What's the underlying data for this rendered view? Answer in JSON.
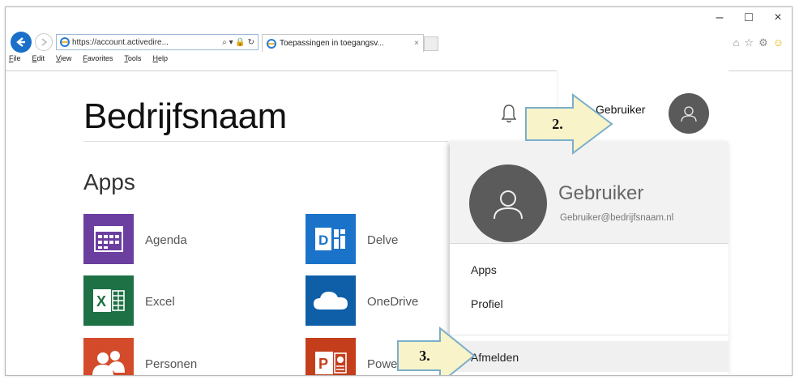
{
  "browser": {
    "url": "https://account.activedire...",
    "address_tools": "⌕ ▾ 🔒 ↻",
    "tab_title": "Toepassingen in toegangsv...",
    "tab_close": "×",
    "window_controls": [
      "–",
      "□",
      "×"
    ],
    "right_icons": [
      "⌂",
      "☆",
      "⚙",
      "☺"
    ],
    "menu": [
      "File",
      "Edit",
      "View",
      "Favorites",
      "Tools",
      "Help"
    ]
  },
  "page": {
    "brand": "Bedrijfsnaam",
    "apps_title": "Apps",
    "apps": [
      {
        "label": "Agenda",
        "color": "#6b3fa0",
        "icon": "calendar-icon"
      },
      {
        "label": "Excel",
        "color": "#1e7145",
        "icon": "excel-icon"
      },
      {
        "label": "Personen",
        "color": "#d34b2a",
        "icon": "people-icon"
      },
      {
        "label": "Delve",
        "color": "#1a73c9",
        "icon": "delve-icon"
      },
      {
        "label": "OneDrive",
        "color": "#0e5fa8",
        "icon": "onedrive-icon"
      },
      {
        "label": "Powe",
        "color": "#c43e1c",
        "icon": "powerpoint-icon"
      }
    ]
  },
  "header": {
    "user_name": "Gebruiker"
  },
  "panel": {
    "name": "Gebruiker",
    "email": "Gebruiker@bedrijfsnaam.nl",
    "links": [
      "Apps",
      "Profiel"
    ],
    "signout": "Afmelden"
  },
  "callouts": [
    {
      "label": "2."
    },
    {
      "label": "3."
    }
  ],
  "colors": {
    "accent_blue": "#1a6fc9",
    "callout_fill": "#f8f3c8",
    "callout_border": "#7aaecc"
  }
}
